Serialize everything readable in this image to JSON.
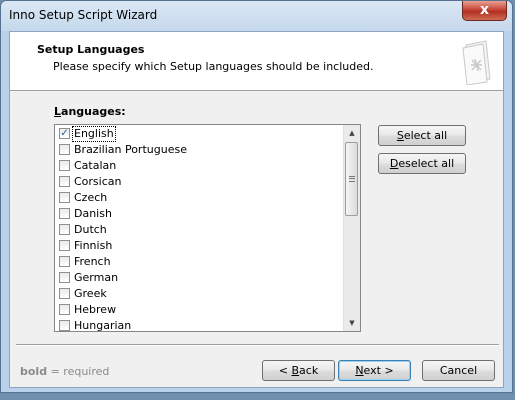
{
  "window": {
    "title": "Inno Setup Script Wizard",
    "close_glyph": "x"
  },
  "header": {
    "title": "Setup Languages",
    "subtitle": "Please specify which Setup languages should be included.",
    "icon": "wizard-page-icon"
  },
  "languages": {
    "label_prefix": "",
    "label_accel": "L",
    "label_rest": "anguages:",
    "items": [
      {
        "label": "English",
        "checked": true
      },
      {
        "label": "Brazilian Portuguese",
        "checked": false
      },
      {
        "label": "Catalan",
        "checked": false
      },
      {
        "label": "Corsican",
        "checked": false
      },
      {
        "label": "Czech",
        "checked": false
      },
      {
        "label": "Danish",
        "checked": false
      },
      {
        "label": "Dutch",
        "checked": false
      },
      {
        "label": "Finnish",
        "checked": false
      },
      {
        "label": "French",
        "checked": false
      },
      {
        "label": "German",
        "checked": false
      },
      {
        "label": "Greek",
        "checked": false
      },
      {
        "label": "Hebrew",
        "checked": false
      },
      {
        "label": "Hungarian",
        "checked": false
      }
    ]
  },
  "buttons": {
    "select_all": {
      "accel": "S",
      "rest": "elect all"
    },
    "deselect_all": {
      "accel": "D",
      "rest": "eselect all"
    },
    "back": {
      "pre": "< ",
      "accel": "B",
      "rest": "ack"
    },
    "next": {
      "accel": "N",
      "rest": "ext >"
    },
    "cancel": "Cancel"
  },
  "footer": {
    "bold": "bold",
    "rest": " = required"
  }
}
